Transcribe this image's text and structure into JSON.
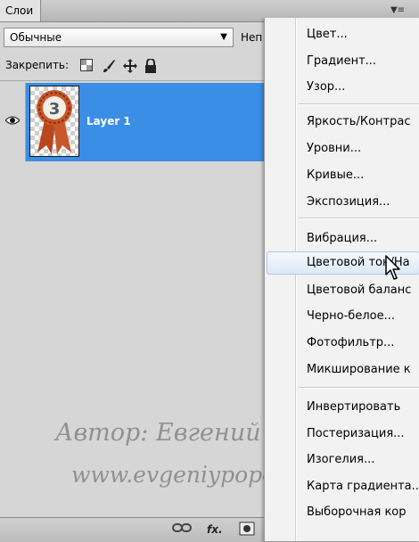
{
  "panel": {
    "tab_label": "Слои",
    "menu_button_icon": "panel-menu-icon",
    "blend_mode": "Обычные",
    "opacity_label": "Неп",
    "lock_label": "Закрепить:",
    "lock_icons": [
      "lock-transparent-icon",
      "brush-icon",
      "move-icon",
      "lock-icon"
    ]
  },
  "layers": [
    {
      "name": "Layer 1",
      "visible": true,
      "selected": true,
      "thumbnail_icon": "ribbon-badge-3-icon",
      "badge_number": "3"
    }
  ],
  "bottom_bar": {
    "icons": [
      "link-icon",
      "fx-icon",
      "mask-icon"
    ],
    "fx_label": "fx."
  },
  "menu": {
    "groups": [
      [
        "Цвет...",
        "Градиент...",
        "Узор..."
      ],
      [
        "Яркость/Контрас",
        "Уровни...",
        "Кривые...",
        "Экспозиция..."
      ],
      [
        "Вибрация...",
        "Цветовой тон/На",
        "Цветовой баланс",
        "Черно-белое...",
        "Фотофильтр...",
        "Микширование к"
      ],
      [
        "Инвертировать",
        "Постеризация...",
        "Изогелия...",
        "Карта градиента...",
        "Выборочная кор"
      ]
    ],
    "highlighted": "Цветовой тон/На"
  },
  "watermark": {
    "line1": "Автор:  Евгений  Попов",
    "line2": "www.evgeniypopov.com"
  },
  "colors": {
    "selection": "#3a8ee6",
    "badge": "#c8572a",
    "menu_bg": "#f2f2f2"
  }
}
